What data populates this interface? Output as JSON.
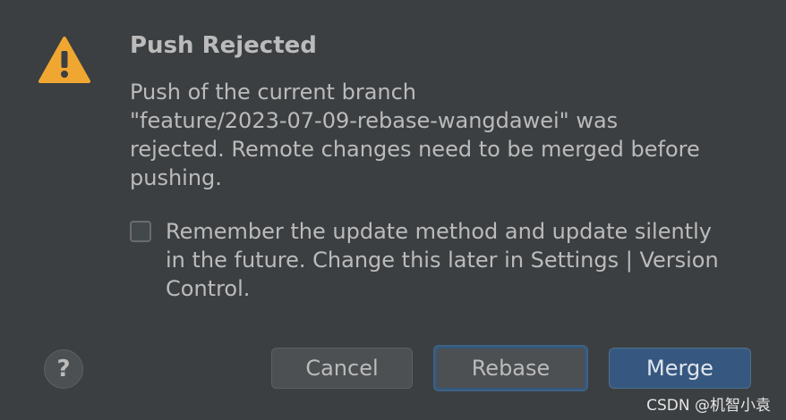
{
  "dialog": {
    "title": "Push Rejected",
    "message_lines": [
      "Push of the current branch",
      "\"feature/2023-07-09-rebase-wangdawei\" was",
      "rejected. Remote changes need to be merged before",
      "pushing."
    ],
    "remember_checkbox": {
      "checked": false,
      "label_lines": [
        "Remember the update method and update silently",
        "in the future. Change this later in Settings | Version",
        "Control."
      ]
    },
    "buttons": {
      "help": "?",
      "cancel": "Cancel",
      "rebase": "Rebase",
      "merge": "Merge"
    },
    "icons": {
      "warning": "warning-triangle-icon"
    }
  },
  "watermark": "CSDN @机智小袁",
  "colors": {
    "background": "#3c3f41",
    "text": "#bbbbbb",
    "warning_fill": "#f0a732",
    "default_button": "#365880"
  }
}
